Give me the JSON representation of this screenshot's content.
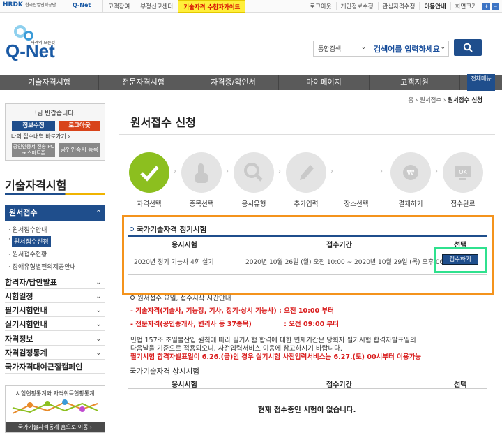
{
  "topbar": {
    "hrdk": "HRDK",
    "hrdk_sub": "한국산업인력공단",
    "qnet_small": "Q-Net",
    "left_links": [
      "고객참여",
      "부정신고센터"
    ],
    "highlight_link": "기술자격 수험자가이드",
    "right_links": [
      "로그아웃",
      "개인정보수정",
      "관심자격수정"
    ],
    "right_bold": "이용안내",
    "zoom_label": "화면크기",
    "zoom_plus": "+",
    "zoom_minus": "−"
  },
  "header": {
    "logo_text": "Q-Net",
    "logo_tag": "자격의 모든것",
    "search_scope": "통합검색",
    "search_placeholder": "검색어를 입력하세요"
  },
  "gnb": {
    "items": [
      "기술자격시험",
      "전문자격시험",
      "자격증/확인서",
      "마이페이지",
      "고객지원"
    ],
    "all_menu": "전체메뉴"
  },
  "login": {
    "greeting": "!님 반갑습니다.",
    "edit_btn": "정보수정",
    "logout_btn": "로그아웃",
    "history_link": "나의 접수내역 바로가기 ›",
    "cert_btn": "공인인증서 전송 PC → 스마트폰",
    "cert_reg_btn": "공인인증서 등록"
  },
  "sidebar": {
    "title": "기술자격시험",
    "active": "원서접수",
    "subitems": [
      "원서접수안내",
      "원서접수신청",
      "원서접수현황",
      "장애유형별편의제공안내"
    ],
    "menus": [
      "합격자/답안발표",
      "시험일정",
      "필기시험안내",
      "실기시험안내",
      "자격정보",
      "자격검정통계",
      "국가자격대여근절캠페인"
    ],
    "stat_title": "시험현황통계와 자격취득현황통계",
    "stat_bottom": "국가기술자격통계 홈으로 이동 ›"
  },
  "breadcrumb": {
    "home": "홈",
    "mid": "원서접수",
    "current": "원서접수 신청"
  },
  "page": {
    "title": "원서접수 신청"
  },
  "steps": [
    "자격선택",
    "종목선택",
    "응시유형",
    "추가입력",
    "장소선택",
    "결제하기",
    "접수완료"
  ],
  "regular": {
    "title": "국가기술자격 정기시험",
    "headers": [
      "응시시험",
      "접수기간",
      "선택"
    ],
    "row": {
      "exam": "2020년 정기 기능사 4회 실기",
      "period": "2020년 10월 26일 (월) 오전 10:00 ~ 2020년 10월 29일 (목) 오후 06:00",
      "action": "접수하기"
    }
  },
  "notice": {
    "head": "원서접수 요일, 접수시작 시간안내",
    "l1": "- 기술자격(기술사, 기능장, 기사, 정기·상시 기능사) : 오전 10:00 부터",
    "l2": "- 전문자격(공인중개사, 변리사 등 37종목)              : 오전 09:00 부터",
    "p1": "민법 157조 초일불산입 원칙에 따라 필기시험 합격에 대한 면제기간은 당회차 필기시험 합격자발표일의",
    "p2": "다음날을 기준으로 적용되오니, 사전입력서비스 이용에 참고하시기 바랍니다.",
    "p3": "필기시험 합격자발표일이 6.26.(금)인 경우 실기시험 사전입력서비스는 6.27.(토) 00시부터 이용가능"
  },
  "permanent": {
    "title": "국가기술자격 상시시험",
    "headers": [
      "응시시험",
      "접수기간",
      "선택"
    ],
    "empty": "현재 접수중인 시험이 없습니다."
  },
  "colors": {
    "brand": "#1f4e8c",
    "step_done": "#8cbf1f",
    "highlight_orange": "#f4931c",
    "highlight_green": "#2fe18e"
  }
}
